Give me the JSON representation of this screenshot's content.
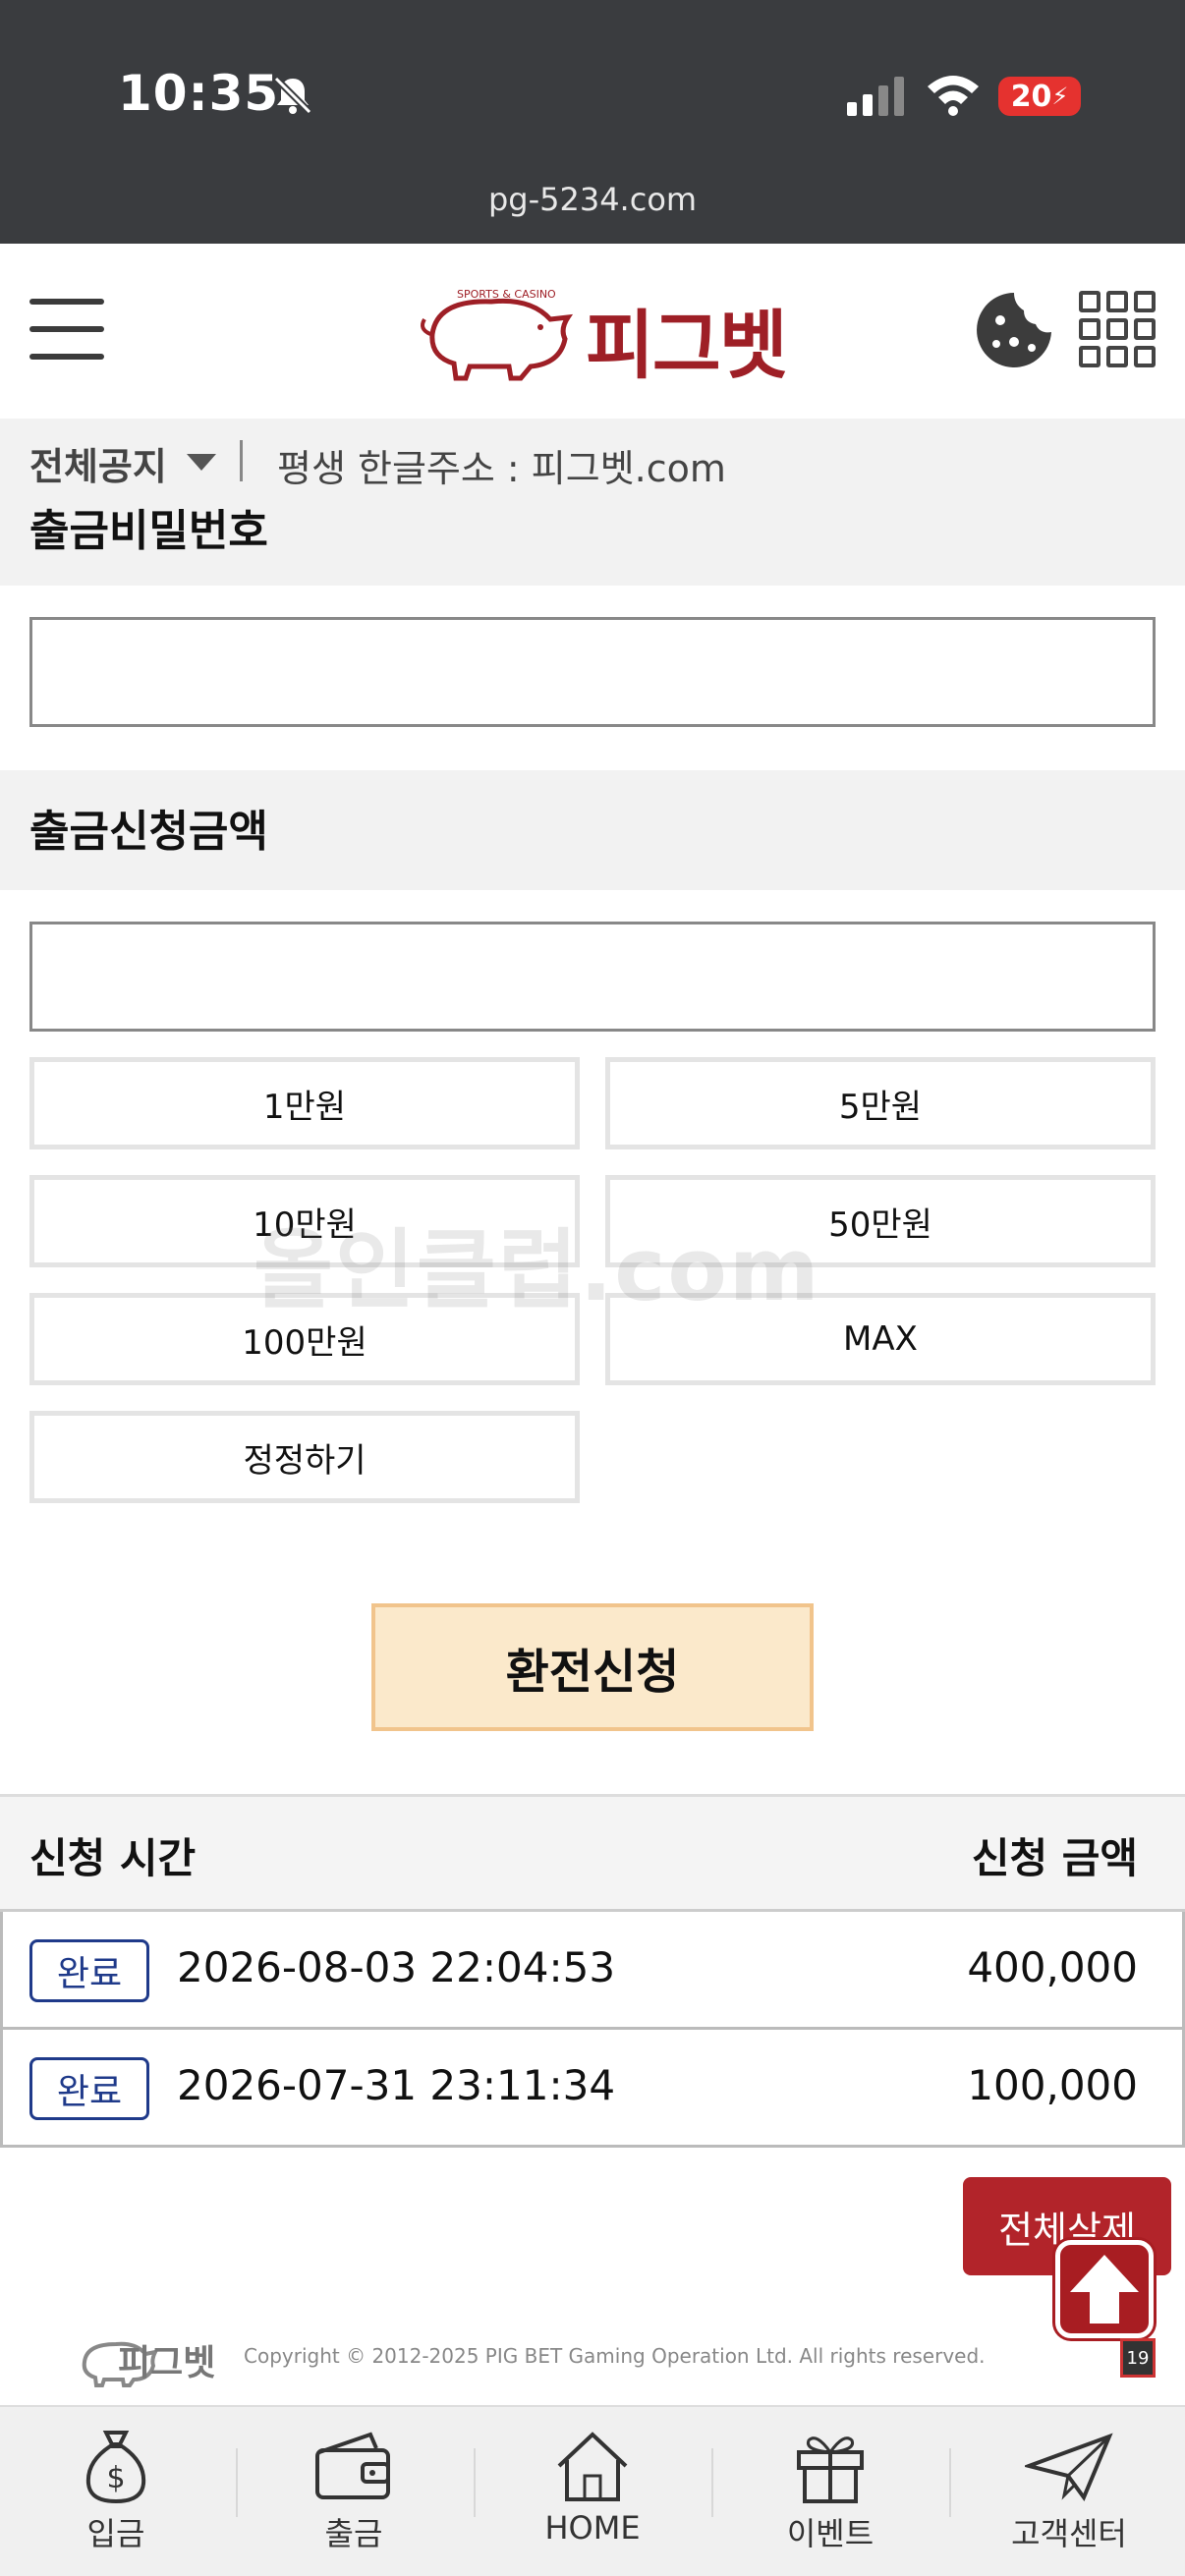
{
  "status_bar": {
    "time": "10:35",
    "battery": "20",
    "url": "pg-5234.com"
  },
  "header": {
    "logo_text": "피그벳",
    "logo_tagline": "SPORTS & CASINO"
  },
  "notice": {
    "category": "전체공지",
    "text": "평생 한글주소 : 피그벳.com"
  },
  "form": {
    "password_label": "출금비밀번호",
    "password_value": "",
    "amount_label": "출금신청금액",
    "amount_value": "",
    "quick_amounts": [
      "1만원",
      "5만원",
      "10만원",
      "50만원",
      "100만원",
      "MAX"
    ],
    "reset_label": "정정하기",
    "submit_label": "환전신청"
  },
  "watermark": "올인클럽.com",
  "history": {
    "col_time": "신청 시간",
    "col_amount": "신청 금액",
    "rows": [
      {
        "status": "완료",
        "time": "2026-08-03 22:04:53",
        "amount": "400,000"
      },
      {
        "status": "완료",
        "time": "2026-07-31 23:11:34",
        "amount": "100,000"
      }
    ],
    "delete_all_label": "전체삭제"
  },
  "footer": {
    "logo_text": "피그벳",
    "copyright": "Copyright © 2012-2025 PIG BET Gaming Operation Ltd. All rights reserved.",
    "age_badge": "19"
  },
  "bottom_nav": {
    "items": [
      {
        "label": "입금",
        "icon": "money-bag-icon"
      },
      {
        "label": "출금",
        "icon": "wallet-icon"
      },
      {
        "label": "HOME",
        "icon": "home-icon"
      },
      {
        "label": "이벤트",
        "icon": "gift-icon"
      },
      {
        "label": "고객센터",
        "icon": "paper-plane-icon"
      }
    ]
  },
  "colors": {
    "brand": "#9e1f26",
    "submit_bg": "#fbe9cb",
    "badge": "#1f3a8a",
    "status_bar": "#3a3c3f"
  }
}
